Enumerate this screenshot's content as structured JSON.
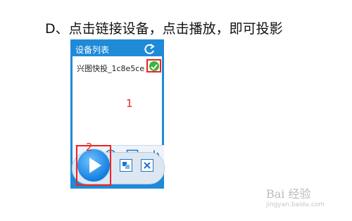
{
  "caption": "D、点击链接设备，点击播放，即可投影",
  "panel": {
    "title": "设备列表",
    "refresh_icon": "refresh-icon",
    "device_name": "兴图快投_1c8e5ce",
    "connected_icon": "check-circle-icon",
    "annotation_1": "1"
  },
  "toolbar": {
    "text_icon": "text-format-icon",
    "play_small_icon": "play-circle-icon",
    "window_icon": "window-icon",
    "power_icon": "power-icon"
  },
  "player": {
    "annotation_2": "2",
    "play_icon": "play-icon",
    "restore_icon": "restore-icon",
    "close_icon": "close-icon"
  },
  "watermark": {
    "text": "Bai 经验",
    "sub": "jingyan.baidu.com"
  },
  "colors": {
    "panel_blue": "#1f8ad8",
    "highlight_red": "#e22",
    "check_green": "#3db33d"
  }
}
